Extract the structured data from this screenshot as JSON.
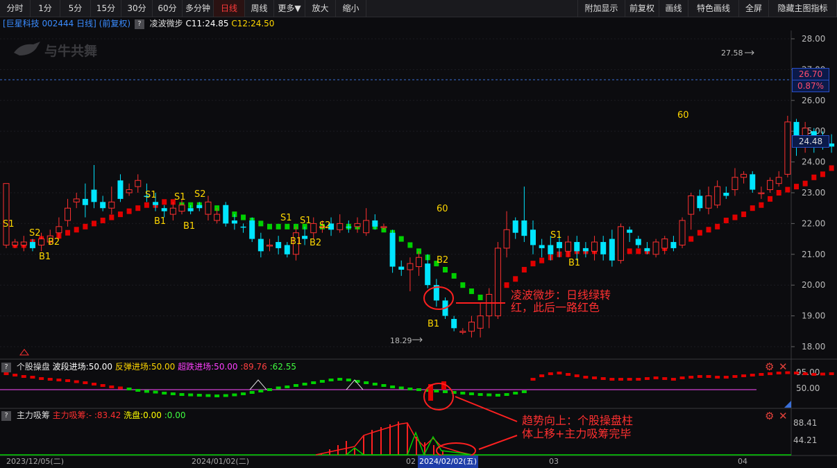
{
  "toolbar": {
    "periods": [
      "分时",
      "1分",
      "5分",
      "15分",
      "30分",
      "60分",
      "多分钟",
      "日线",
      "周线",
      "更多▼",
      "放大",
      "缩小"
    ],
    "active_period": "日线",
    "right_buttons": [
      "附加显示",
      "前复权",
      "画线",
      "特色画线",
      "全屏",
      "隐藏主图指标"
    ]
  },
  "main": {
    "stock": "[巨星科技 002444 日线]",
    "adjust": "(前复权)",
    "indicator_name": "凌波微步",
    "c1": "C11:24.85",
    "c2": "C12:24.50",
    "watermark": "与牛共舞",
    "y_ticks": [
      "28.00",
      "27.00",
      "26.00",
      "25.00",
      "24.00",
      "23.00",
      "22.00",
      "21.00",
      "20.00",
      "19.00",
      "18.00"
    ],
    "price_tag": "26.70",
    "pct_tag": "0.87%",
    "ma_tag": "24.48",
    "high_label": "27.58",
    "low_label": "18.29",
    "annotation": [
      "凌波微步：日线绿转",
      "红，此后一路红色"
    ]
  },
  "panel1": {
    "name": "个股操盘",
    "labels": [
      {
        "text": "波段进场:50.00",
        "color": "#ffffff"
      },
      {
        "text": "反弹进场:50.00",
        "color": "#ffd700"
      },
      {
        "text": "超跌进场:50.00",
        "color": "#ff40ff"
      },
      {
        "text": ":89.76",
        "color": "#ff4040"
      },
      {
        "text": ":62.55",
        "color": "#40ff40"
      }
    ],
    "y_ticks": [
      "95.00",
      "50.00"
    ],
    "annotation": [
      "趋势向上：个股操盘柱",
      "体上移+主力吸筹完毕"
    ]
  },
  "panel2": {
    "name": "主力吸筹",
    "labels": [
      {
        "text": "主力吸筹:-",
        "color": "#ff3030"
      },
      {
        "text": ":83.42",
        "color": "#ff3030"
      },
      {
        "text": "洗盘:0.00",
        "color": "#ffff00"
      },
      {
        "text": ":0.00",
        "color": "#40ff40"
      }
    ],
    "y_ticks": [
      "88.41",
      "44.21"
    ]
  },
  "dates": [
    "2023/12/05(二)",
    "2024/01/02(二)",
    "02",
    "2024/02/02(五)",
    "03",
    "04"
  ],
  "colors": {
    "up": "#ff3030",
    "down": "#00e5ff",
    "green": "#00d000",
    "yellow": "#ffd700",
    "accent": "#ff3b3b"
  }
}
